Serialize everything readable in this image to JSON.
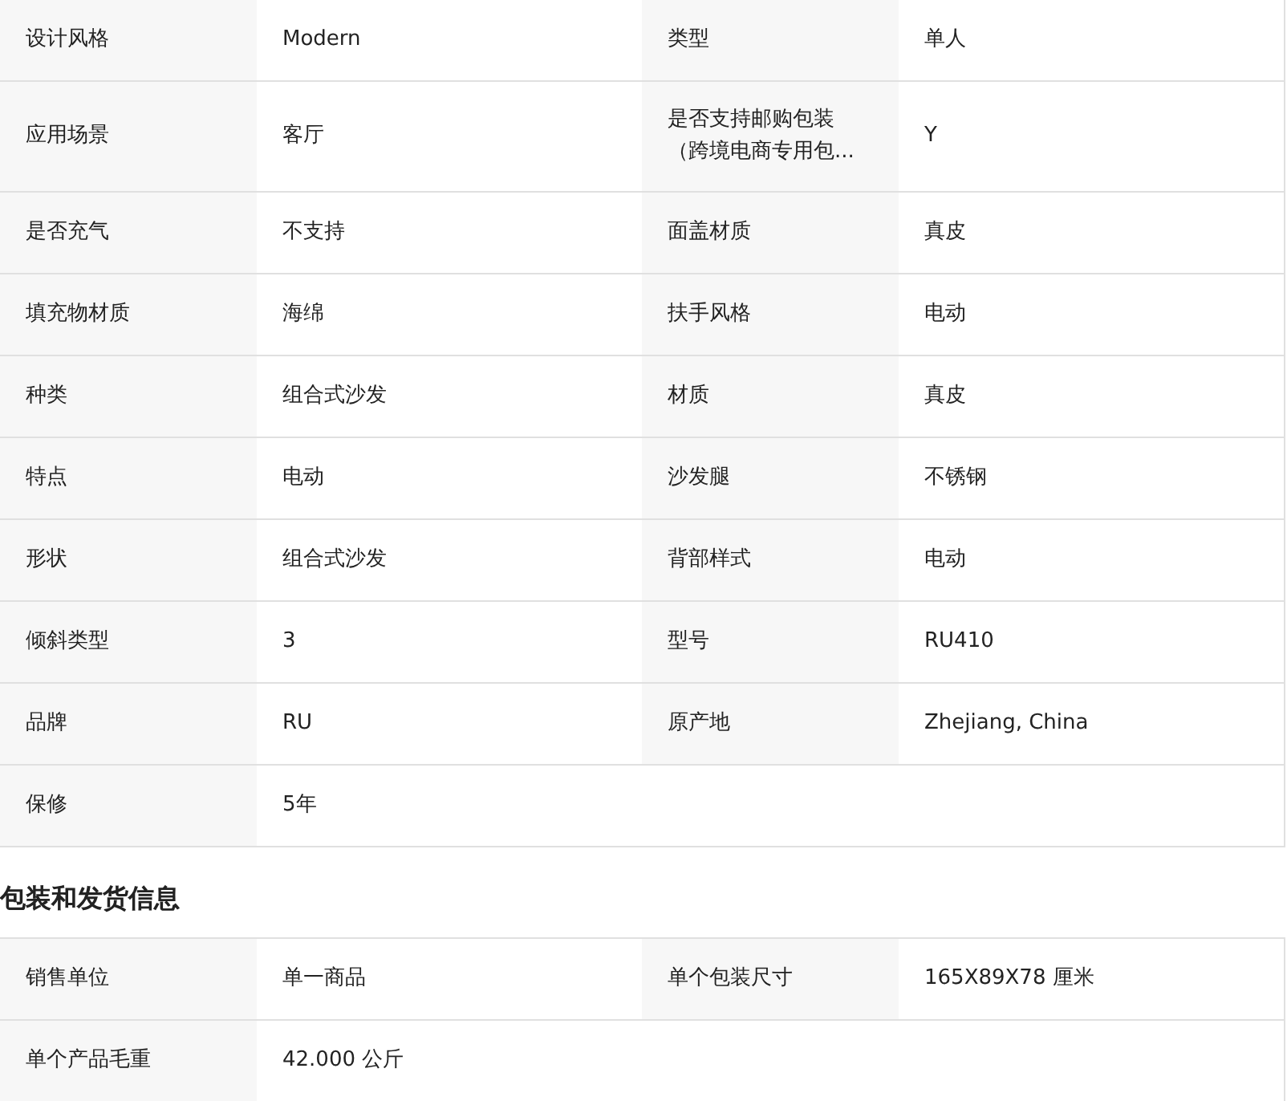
{
  "sections": [
    {
      "rows": [
        [
          {
            "label": "设计风格",
            "value": "Modern"
          },
          {
            "label": "类型",
            "value": "单人"
          }
        ],
        [
          {
            "label": "应用场景",
            "value": "客厅"
          },
          {
            "label": "是否支持邮购包装（跨境电商专用包...",
            "value": "Y"
          }
        ],
        [
          {
            "label": "是否充气",
            "value": "不支持"
          },
          {
            "label": "面盖材质",
            "value": "真皮"
          }
        ],
        [
          {
            "label": "填充物材质",
            "value": "海绵"
          },
          {
            "label": "扶手风格",
            "value": "电动"
          }
        ],
        [
          {
            "label": "种类",
            "value": "组合式沙发"
          },
          {
            "label": "材质",
            "value": "真皮"
          }
        ],
        [
          {
            "label": "特点",
            "value": "电动"
          },
          {
            "label": "沙发腿",
            "value": "不锈钢"
          }
        ],
        [
          {
            "label": "形状",
            "value": "组合式沙发"
          },
          {
            "label": "背部样式",
            "value": "电动"
          }
        ],
        [
          {
            "label": "倾斜类型",
            "value": "3"
          },
          {
            "label": "型号",
            "value": "RU410"
          }
        ],
        [
          {
            "label": "品牌",
            "value": "RU"
          },
          {
            "label": "原产地",
            "value": "Zhejiang, China"
          }
        ],
        [
          {
            "label": "保修",
            "value": "5年"
          }
        ]
      ]
    },
    {
      "title": "包装和发货信息",
      "rows": [
        [
          {
            "label": "销售单位",
            "value": "单一商品"
          },
          {
            "label": "单个包装尺寸",
            "value": "165X89X78 厘米"
          }
        ],
        [
          {
            "label": "单个产品毛重",
            "value": "42.000 公斤"
          }
        ]
      ]
    }
  ]
}
